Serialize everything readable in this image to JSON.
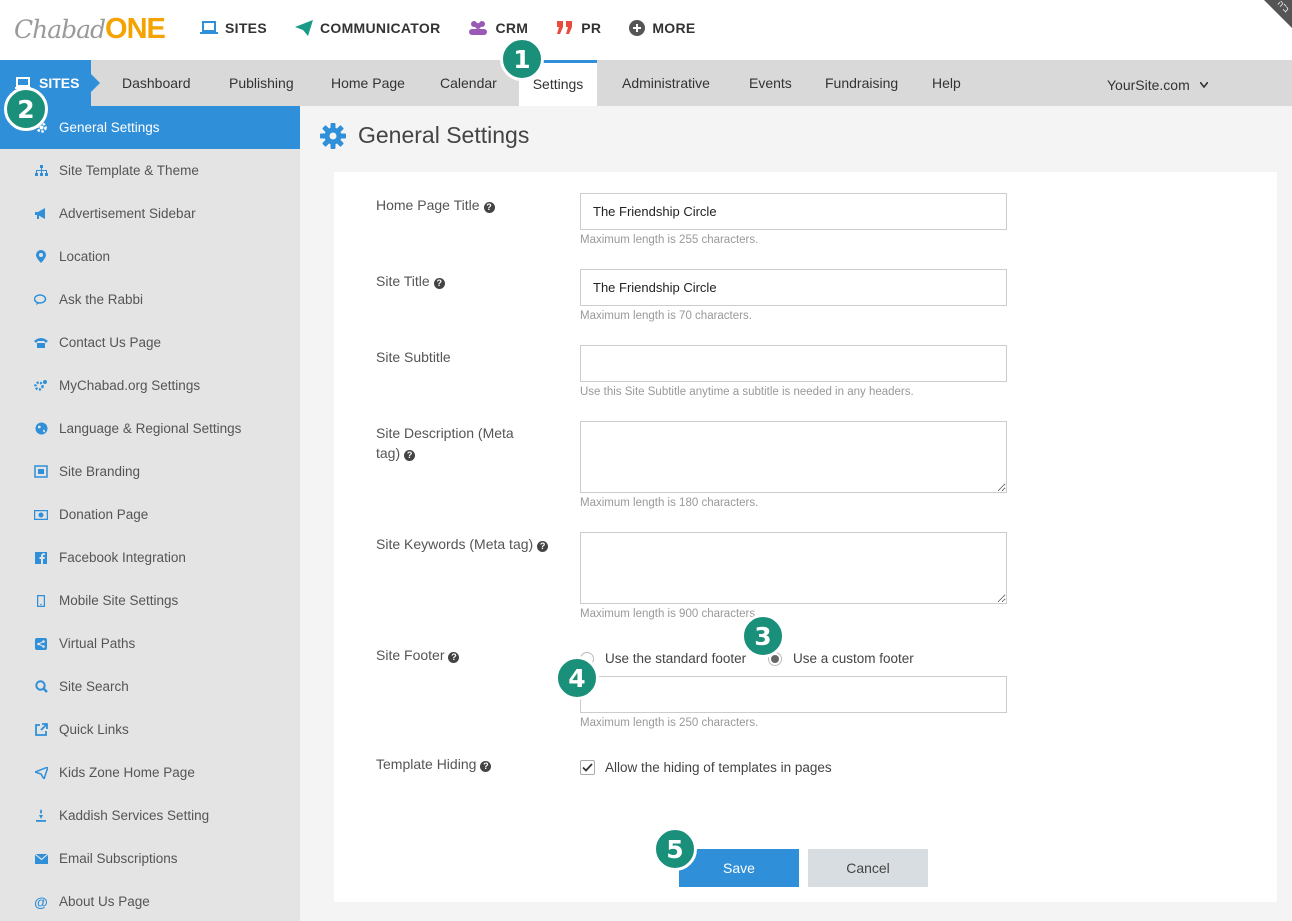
{
  "logo": {
    "part1": "Chabad",
    "part2": "ONE"
  },
  "topnav": [
    {
      "label": "SITES",
      "icon": "laptop-icon",
      "color": "#2f8fd9"
    },
    {
      "label": "COMMUNICATOR",
      "icon": "paper-plane-icon",
      "color": "#1a9b8a"
    },
    {
      "label": "CRM",
      "icon": "users-icon",
      "color": "#9b59b6"
    },
    {
      "label": "PR",
      "icon": "quote-icon",
      "color": "#e74c3c"
    },
    {
      "label": "MORE",
      "icon": "plus-circle-icon",
      "color": "#555555"
    }
  ],
  "corner_label": "ב\"ה",
  "subnav": {
    "sites_label": "SITES",
    "items": [
      "Dashboard",
      "Publishing",
      "Home Page",
      "Calendar",
      "Settings",
      "Administrative",
      "Events",
      "Fundraising",
      "Help"
    ],
    "active": "Settings",
    "site_selector": "YourSite.com"
  },
  "sidebar": {
    "items": [
      {
        "label": "General Settings",
        "icon": "gear-icon"
      },
      {
        "label": "Site Template & Theme",
        "icon": "sitemap-icon"
      },
      {
        "label": "Advertisement Sidebar",
        "icon": "megaphone-icon"
      },
      {
        "label": "Location",
        "icon": "map-pin-icon"
      },
      {
        "label": "Ask the Rabbi",
        "icon": "chat-icon"
      },
      {
        "label": "Contact Us Page",
        "icon": "phone-icon"
      },
      {
        "label": "MyChabad.org Settings",
        "icon": "cogs-icon"
      },
      {
        "label": "Language & Regional Settings",
        "icon": "globe-icon"
      },
      {
        "label": "Site Branding",
        "icon": "frame-icon"
      },
      {
        "label": "Donation Page",
        "icon": "money-icon"
      },
      {
        "label": "Facebook Integration",
        "icon": "facebook-icon"
      },
      {
        "label": "Mobile Site Settings",
        "icon": "mobile-icon"
      },
      {
        "label": "Virtual Paths",
        "icon": "share-icon"
      },
      {
        "label": "Site Search",
        "icon": "search-icon"
      },
      {
        "label": "Quick Links",
        "icon": "external-link-icon"
      },
      {
        "label": "Kids Zone Home Page",
        "icon": "paper-plane-icon"
      },
      {
        "label": "Kaddish Services Setting",
        "icon": "candle-icon"
      },
      {
        "label": "Email Subscriptions",
        "icon": "envelope-icon"
      },
      {
        "label": "About Us Page",
        "icon": "at-icon"
      }
    ]
  },
  "page": {
    "title": "General Settings"
  },
  "form": {
    "home_title": {
      "label": "Home Page Title",
      "value": "The Friendship Circle",
      "hint": "Maximum length is 255 characters."
    },
    "site_title": {
      "label": "Site Title",
      "value": "The Friendship Circle",
      "hint": "Maximum length is 70 characters."
    },
    "subtitle": {
      "label": "Site Subtitle",
      "value": "",
      "hint": "Use this Site Subtitle anytime a subtitle is needed in any headers."
    },
    "description": {
      "label": "Site Description (Meta tag)",
      "value": "",
      "hint": "Maximum length is 180 characters."
    },
    "keywords": {
      "label": "Site Keywords (Meta tag)",
      "value": "",
      "hint": "Maximum length is 900 characters."
    },
    "footer": {
      "label": "Site Footer",
      "option_standard": "Use the standard footer",
      "option_custom": "Use a custom footer",
      "selected": "custom",
      "value": "",
      "hint": "Maximum length is 250 characters."
    },
    "template_hiding": {
      "label": "Template Hiding",
      "checkbox_label": "Allow the hiding of templates in pages",
      "checked": true
    }
  },
  "buttons": {
    "save": "Save",
    "cancel": "Cancel"
  },
  "badges": [
    "1",
    "2",
    "3",
    "4",
    "5"
  ],
  "colors": {
    "accent": "#2f8fd9",
    "badge": "#1a8f7a",
    "logo_one": "#f5a300"
  }
}
